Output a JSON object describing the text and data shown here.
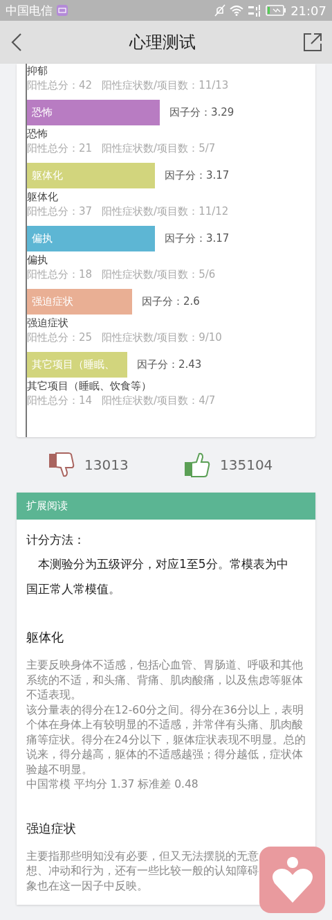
{
  "status_bar": {
    "carrier": "中国电信",
    "time": "21:07"
  },
  "header": {
    "title": "心理测试"
  },
  "factors": [
    {
      "kind": "cut",
      "name": "抑郁",
      "total": "阳性总分：42",
      "ratio": "阳性症状数/项目数：11/13"
    },
    {
      "kind": "bar",
      "bar_label": "恐怖",
      "score": "因子分：3.29",
      "color": "#b87cc2",
      "name": "恐怖",
      "total": "阳性总分：21",
      "ratio": "阳性症状数/项目数：5/7"
    },
    {
      "kind": "bar",
      "bar_label": "躯体化",
      "score": "因子分：3.17",
      "color": "#d2d57d",
      "name": "躯体化",
      "total": "阳性总分：37",
      "ratio": "阳性症状数/项目数：11/12"
    },
    {
      "kind": "bar",
      "bar_label": "偏执",
      "score": "因子分：3.17",
      "color": "#5db6d4",
      "name": "偏执",
      "total": "阳性总分：18",
      "ratio": "阳性症状数/项目数：5/6"
    },
    {
      "kind": "bar",
      "bar_label": "强迫症状",
      "score": "因子分：2.6",
      "color": "#e9af94",
      "name": "强迫症状",
      "total": "阳性总分：25",
      "ratio": "阳性症状数/项目数：9/10"
    },
    {
      "kind": "bar",
      "bar_label": "其它项目（睡眠、",
      "score": "因子分：2.43",
      "color": "#d2d57d",
      "name": "其它项目（睡眠、饮食等）",
      "total": "阳性总分：14",
      "ratio": "阳性症状数/项目数：4/7"
    }
  ],
  "votes": {
    "dislikes": "13013",
    "likes": "135104"
  },
  "reading": {
    "title": "扩展阅读",
    "blocks": [
      {
        "kind": "heading",
        "text": "计分方法："
      },
      {
        "kind": "lead",
        "text": "　本测验分为五级评分，对应1至5分。常模表为中国正常人常模值。"
      },
      {
        "kind": "section",
        "text": "躯体化"
      },
      {
        "kind": "paragraph",
        "text": "主要反映身体不适感，包括心血管、胃肠道、呼吸和其他系统的不适，和头痛、背痛、肌肉酸痛，以及焦虑等躯体不适表现。"
      },
      {
        "kind": "paragraph",
        "text": "该分量表的得分在12-60分之间。得分在36分以上，表明个体在身体上有较明显的不适感，并常伴有头痛、肌肉酸痛等症状。得分在24分以下，躯体症状表现不明显。总的说来，得分越高，躯体的不适感越强；得分越低，症状体验越不明显。"
      },
      {
        "kind": "paragraph",
        "text": "中国常模 平均分 1.37 标准差 0.48"
      },
      {
        "kind": "section",
        "text": "强迫症状"
      },
      {
        "kind": "line",
        "text": "主要指那些明知没有必要，但又无法摆脱的无意"
      },
      {
        "kind": "line",
        "text": "想、冲动和行为，还有一些比较一般的认知障碍"
      },
      {
        "kind": "line",
        "text": "象也在这一因子中反映。"
      }
    ]
  }
}
